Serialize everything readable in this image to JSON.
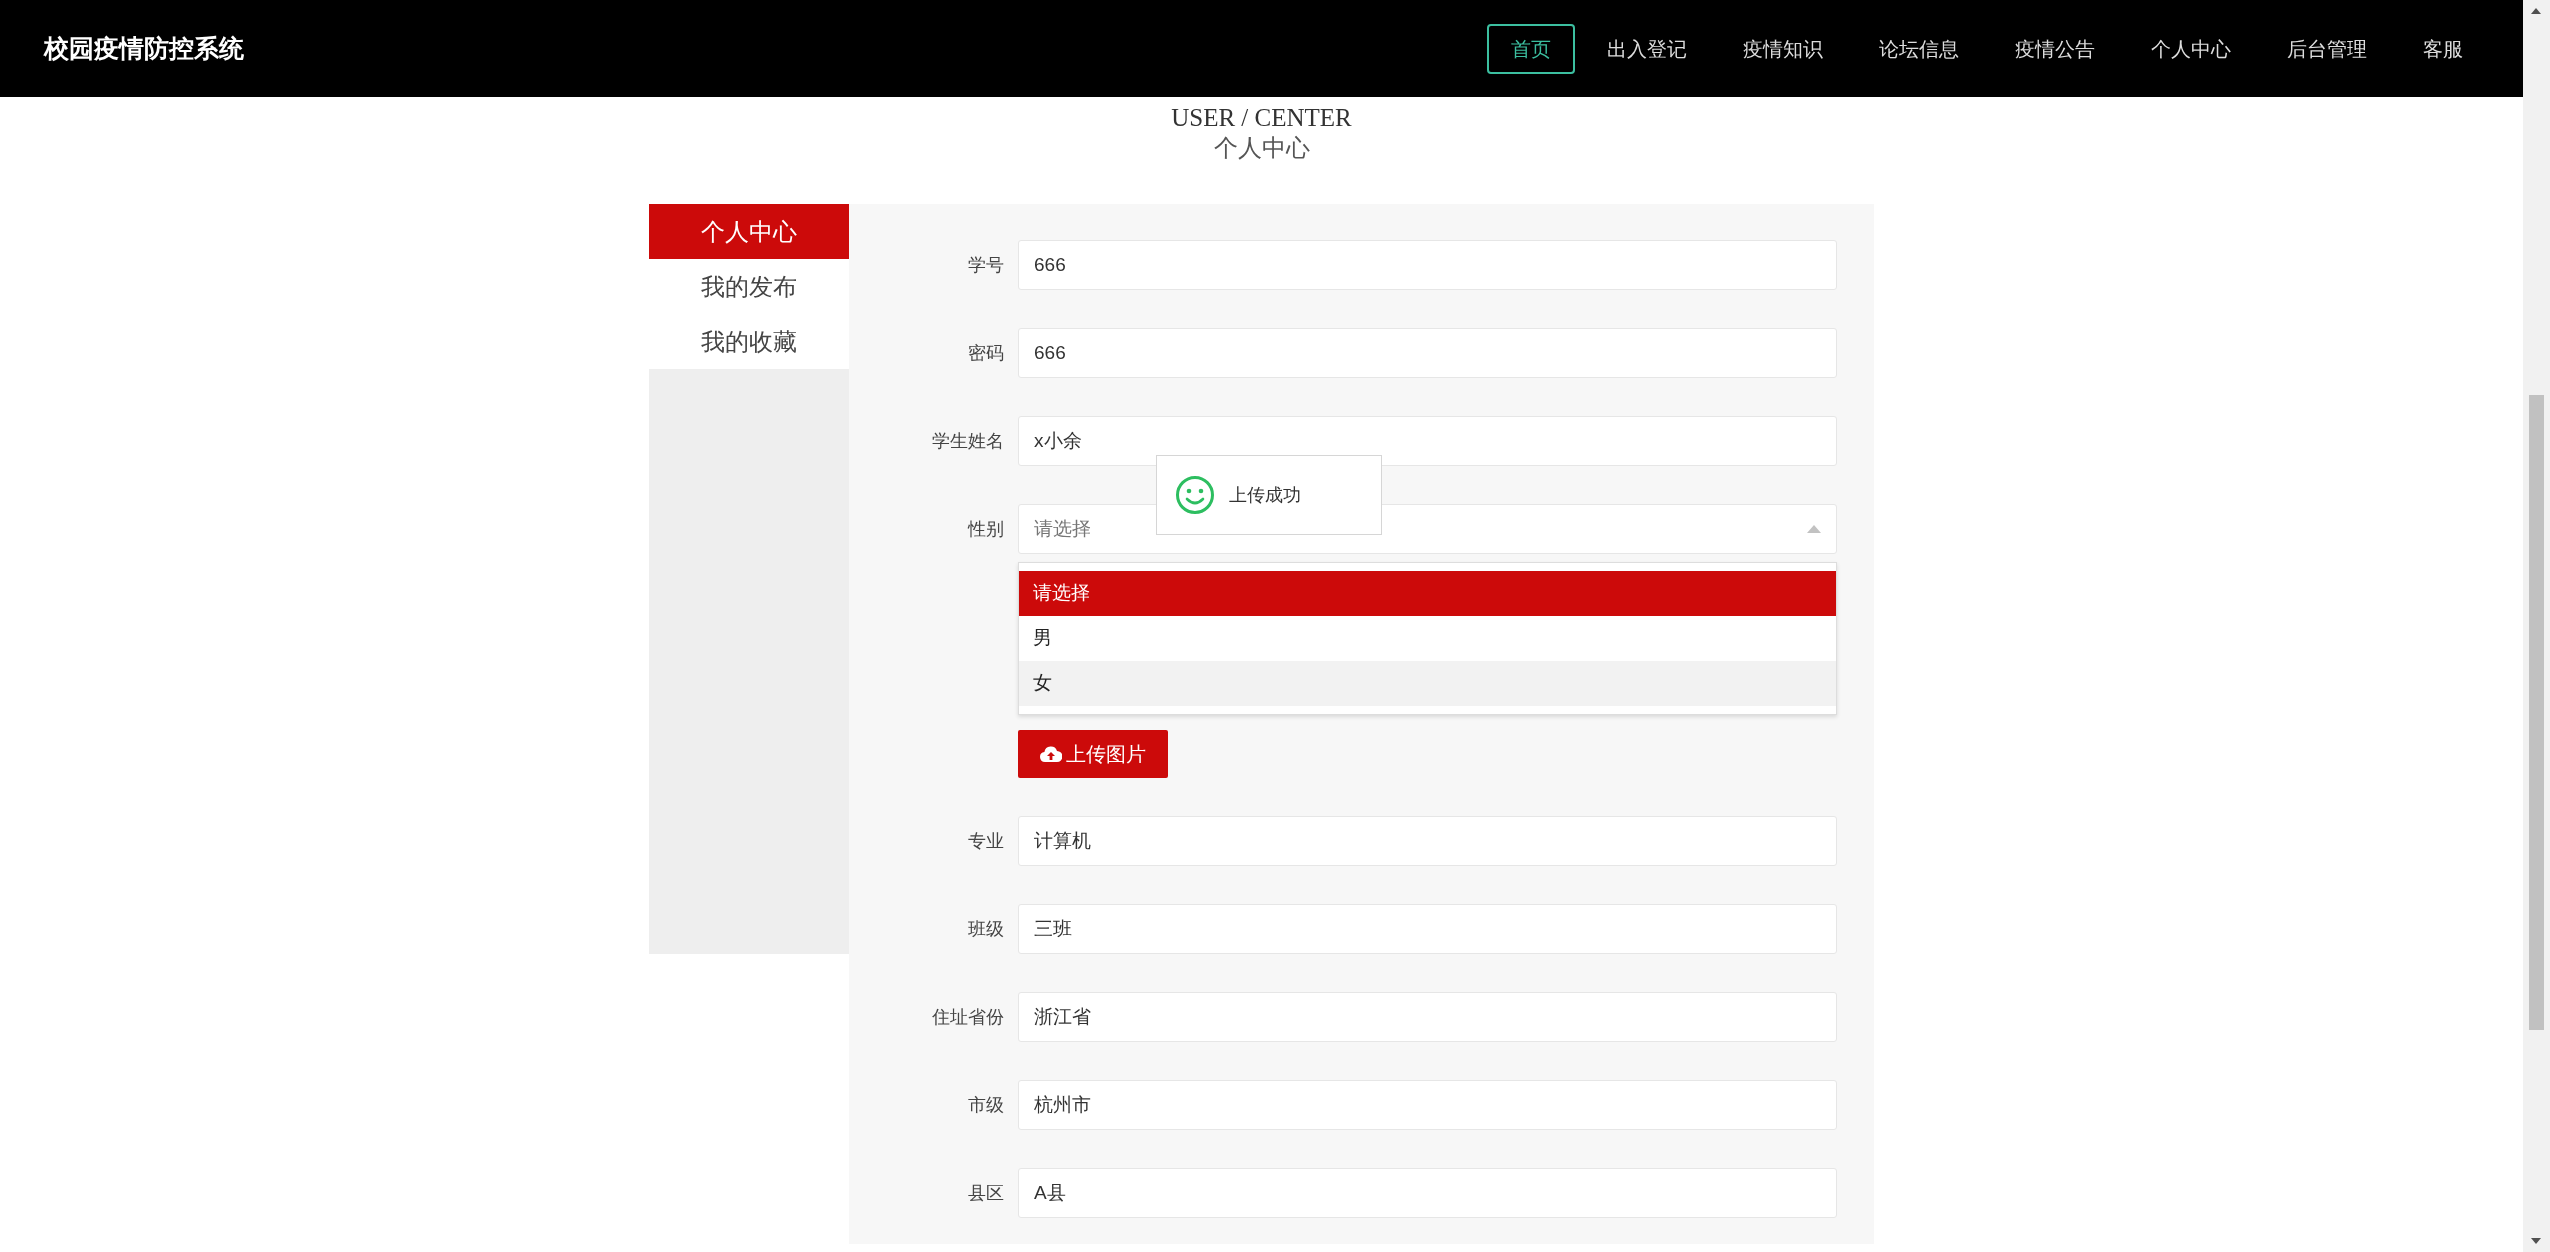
{
  "navbar": {
    "brand": "校园疫情防控系统",
    "items": [
      {
        "label": "首页",
        "selected": true
      },
      {
        "label": "出入登记",
        "selected": false
      },
      {
        "label": "疫情知识",
        "selected": false
      },
      {
        "label": "论坛信息",
        "selected": false
      },
      {
        "label": "疫情公告",
        "selected": false
      },
      {
        "label": "个人中心",
        "selected": false
      },
      {
        "label": "后台管理",
        "selected": false
      },
      {
        "label": "客服",
        "selected": false
      }
    ]
  },
  "header": {
    "title_en": "USER / CENTER",
    "title": "个人中心"
  },
  "sidebar": {
    "items": [
      {
        "label": "个人中心",
        "selected": true
      },
      {
        "label": "我的发布",
        "selected": false
      },
      {
        "label": "我的收藏",
        "selected": false
      }
    ]
  },
  "form": {
    "fields": [
      {
        "kind": "text",
        "label": "学号",
        "value": "666"
      },
      {
        "kind": "text",
        "label": "密码",
        "value": "666"
      },
      {
        "kind": "text",
        "label": "学生姓名",
        "value": "x小余"
      },
      {
        "kind": "select",
        "label": "性别",
        "placeholder": "请选择",
        "expanded": true,
        "options": [
          {
            "label": "请选择",
            "selected": true,
            "hovered": false
          },
          {
            "label": "男",
            "selected": false,
            "hovered": false
          },
          {
            "label": "女",
            "selected": false,
            "hovered": true
          }
        ]
      },
      {
        "kind": "upload",
        "button": "上传图片"
      },
      {
        "kind": "text",
        "label": "专业",
        "value": "计算机"
      },
      {
        "kind": "text",
        "label": "班级",
        "value": "三班"
      },
      {
        "kind": "text",
        "label": "住址省份",
        "value": "浙江省"
      },
      {
        "kind": "text",
        "label": "市级",
        "value": "杭州市"
      },
      {
        "kind": "text",
        "label": "县区",
        "value": "A县"
      }
    ]
  },
  "toast": {
    "message": "上传成功"
  }
}
